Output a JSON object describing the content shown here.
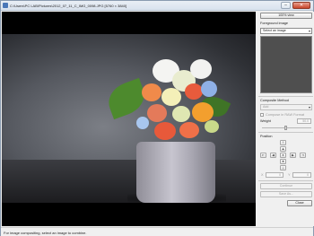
{
  "window": {
    "title": "C:\\Users\\PC LAB\\Pictures\\2012_07_11_C_IMG_0098.JPG [5760 × 3840]",
    "minimize_glyph": "–",
    "close_glyph": "✕"
  },
  "panel": {
    "view_button": "100% view",
    "foreground_heading": "Foreground image",
    "foreground_select": "Select an image",
    "composite_heading": "Composite Method",
    "composite_select": "Add",
    "raw_checkbox_label": "Compose in RAW Format",
    "weight_label": "Weight",
    "weight_value": "50.0",
    "position_heading": "Position",
    "x_label": "X",
    "x_value": "0",
    "y_label": "Y",
    "y_value": "0",
    "continue_button": "Continue",
    "save_button": "Save As...",
    "close_button": "Close"
  },
  "position_pad": {
    "up_top": "⤒",
    "up": "▲",
    "left_end": "⇤",
    "left": "◀",
    "center": "●",
    "right": "▶",
    "right_end": "⇥",
    "down": "▼",
    "down_bottom": "⤓"
  },
  "status": {
    "text": "For image compositing, select an image to combine."
  },
  "colors": {
    "preview_background": "#4f4f4f",
    "image_background": "#000000",
    "close_button": "#c8442a"
  }
}
